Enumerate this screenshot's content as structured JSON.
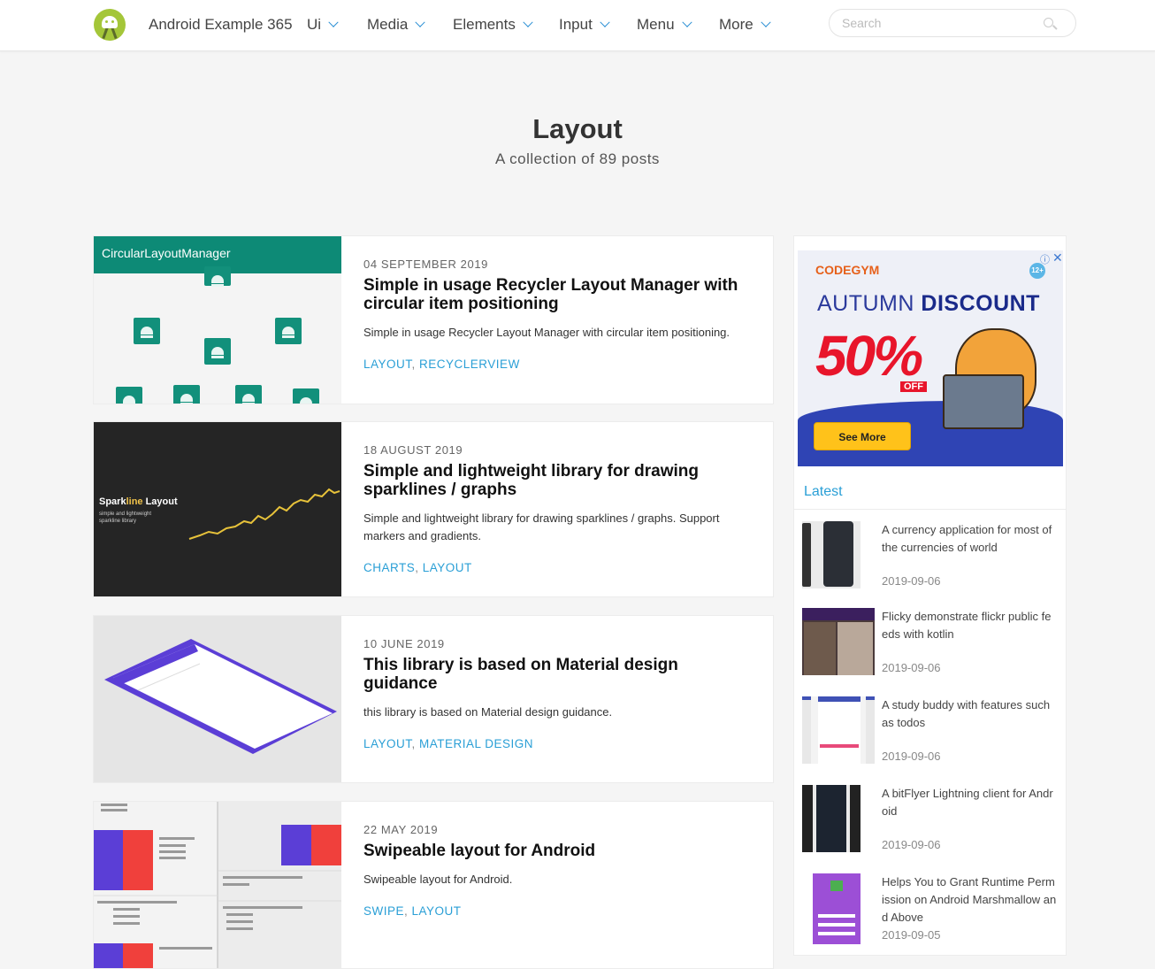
{
  "nav": {
    "site_title": "Android Example 365",
    "menu": [
      {
        "label": "Ui"
      },
      {
        "label": "Media"
      },
      {
        "label": "Elements"
      },
      {
        "label": "Input"
      },
      {
        "label": "Menu"
      },
      {
        "label": "More"
      }
    ],
    "search_placeholder": "Search"
  },
  "header": {
    "title": "Layout",
    "subtitle": "A collection of 89 posts"
  },
  "posts": [
    {
      "thumb_label": "CircularLayoutManager",
      "date": "04 SEPTEMBER 2019",
      "title": "Simple in usage Recycler Layout Manager with circular item positioning",
      "excerpt": "Simple in usage Recycler Layout Manager with circular item positioning.",
      "tags": [
        "LAYOUT",
        "RECYCLERVIEW"
      ]
    },
    {
      "thumb_label_a": "Spark",
      "thumb_label_b": "line",
      "thumb_label_c": " Layout",
      "thumb_small_1": "simple and lightweight",
      "thumb_small_2": "sparkline library",
      "date": "18 AUGUST 2019",
      "title": "Simple and lightweight library for drawing sparklines / graphs",
      "excerpt": "Simple and lightweight library for drawing sparklines / graphs. Support markers and gradients.",
      "tags": [
        "CHARTS",
        "LAYOUT"
      ]
    },
    {
      "date": "10 JUNE 2019",
      "title": "This library is based on Material design guidance",
      "excerpt": "this library is based on Material design guidance.",
      "tags": [
        "LAYOUT",
        "MATERIAL DESIGN"
      ]
    },
    {
      "date": "22 MAY 2019",
      "title": "Swipeable layout for Android",
      "excerpt": "Swipeable layout for Android.",
      "tags": [
        "SWIPE",
        "LAYOUT"
      ]
    }
  ],
  "sidebar": {
    "ad": {
      "brand_a": "CODE",
      "brand_b": "GYM",
      "age": "12+",
      "headline_a": "AUTUMN ",
      "headline_b": "DISCOUNT",
      "big": "50%",
      "off": "OFF",
      "cta": "See More"
    },
    "latest_title": "Latest",
    "latest": [
      {
        "text": "A currency application for most of the currencies of world",
        "date": "2019-09-06"
      },
      {
        "text": "Flicky demonstrate flickr public fe eds with kotlin",
        "date": "2019-09-06"
      },
      {
        "text": "A study buddy with features such as todos",
        "date": "2019-09-06"
      },
      {
        "text": "A bitFlyer Lightning client for Andr oid",
        "date": "2019-09-06"
      },
      {
        "text": "Helps You to Grant Runtime Perm ission on Android Marshmallow an d Above",
        "date": "2019-09-05"
      }
    ]
  },
  "colors": {
    "accent": "#2a9fd6",
    "teal": "#0d8a76",
    "purple": "#5b3ed6"
  }
}
